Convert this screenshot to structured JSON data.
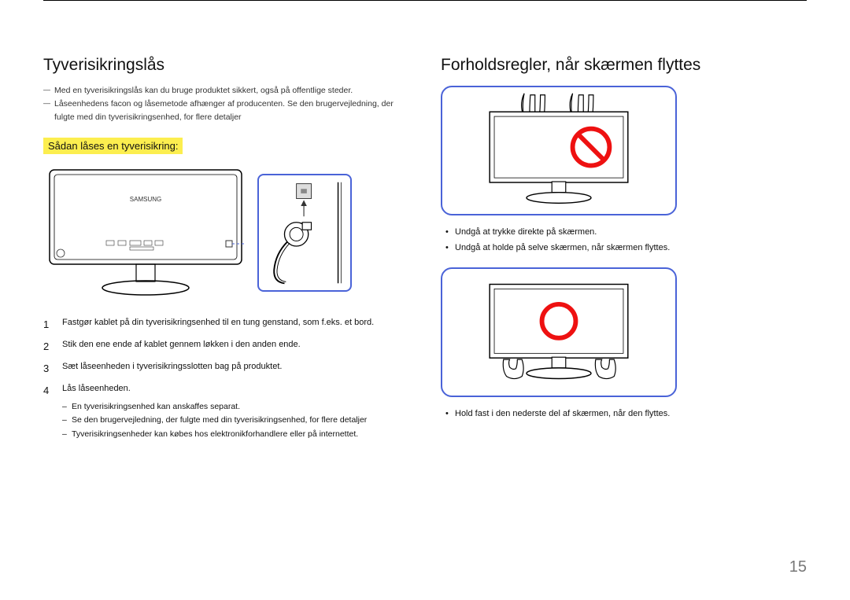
{
  "left": {
    "heading": "Tyverisikringslås",
    "note1": "Med en tyverisikringslås kan du bruge produktet sikkert, også på offentlige steder.",
    "note2": "Låseenhedens facon og låsemetode afhænger af producenten. Se den brugervejledning, der fulgte med din tyverisikringsenhed, for flere detaljer",
    "subheading": "Sådan låses en tyverisikring:",
    "steps": {
      "s1": "Fastgør kablet på din tyverisikringsenhed til en tung genstand, som f.eks. et bord.",
      "s2": "Stik den ene ende af kablet gennem løkken i den anden ende.",
      "s3": "Sæt låseenheden i tyverisikringsslotten bag på produktet.",
      "s4": "Lås låseenheden.",
      "sub1": "En tyverisikringsenhed kan anskaffes separat.",
      "sub2": "Se den brugervejledning, der fulgte med din tyverisikringsenhed, for flere detaljer",
      "sub3": "Tyverisikringsenheder kan købes hos elektronikforhandlere eller på internettet."
    }
  },
  "right": {
    "heading": "Forholdsregler, når skærmen flyttes",
    "bullets1": {
      "b1": "Undgå at trykke direkte på skærmen.",
      "b2": "Undgå at holde på selve skærmen, når skærmen flyttes."
    },
    "bullets2": {
      "b1": "Hold fast i den nederste del af skærmen, når den flyttes."
    }
  },
  "pagenum": "15",
  "icons": {
    "prohibit": "prohibit-icon",
    "permit": "permit-icon",
    "lock": "lock-icon"
  }
}
